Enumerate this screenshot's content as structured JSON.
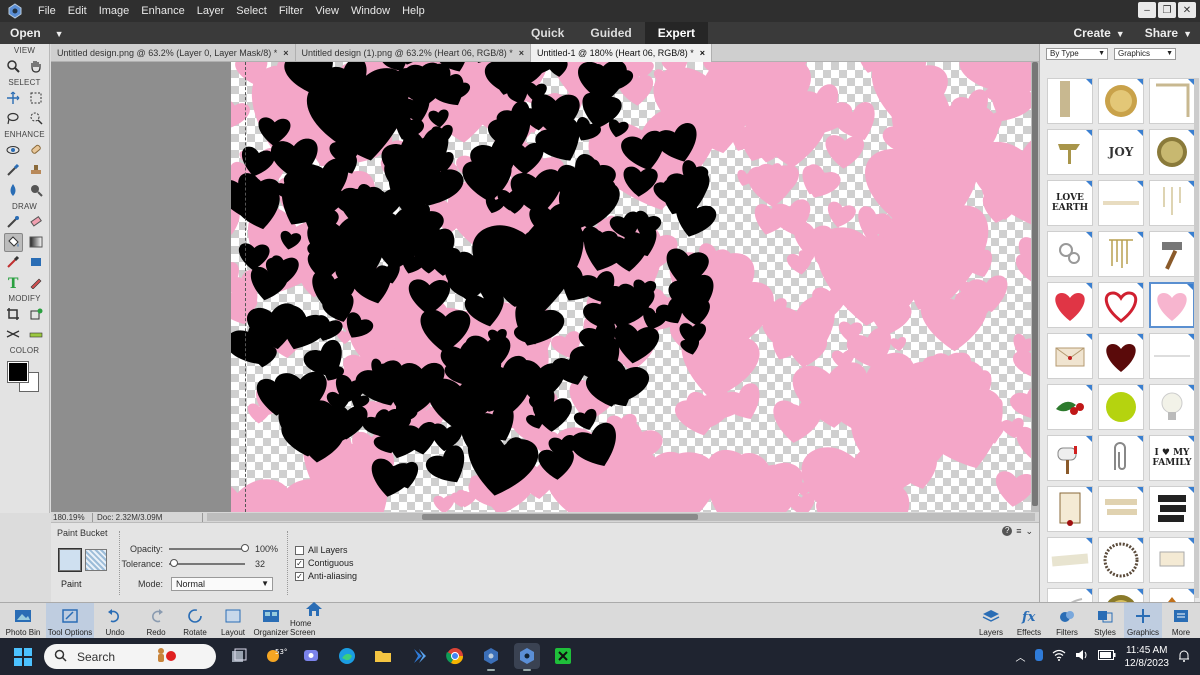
{
  "menubar": {
    "items": [
      "File",
      "Edit",
      "Image",
      "Enhance",
      "Layer",
      "Select",
      "Filter",
      "View",
      "Window",
      "Help"
    ]
  },
  "modebar": {
    "open_label": "Open",
    "modes": [
      "Quick",
      "Guided",
      "Expert"
    ],
    "active_mode": "Expert",
    "create_label": "Create",
    "share_label": "Share"
  },
  "toolbox": {
    "sections": {
      "view": "VIEW",
      "select": "SELECT",
      "enhance": "ENHANCE",
      "draw": "DRAW",
      "modify": "MODIFY",
      "color": "COLOR"
    },
    "foreground_color": "#000000",
    "background_color": "#ffffff"
  },
  "tabs": [
    {
      "label": "Untitled design.png @ 63.2% (Layer 0, Layer Mask/8) *",
      "close": "×"
    },
    {
      "label": "Untitled design (1).png @ 63.2% (Heart 06, RGB/8) *",
      "close": "×"
    },
    {
      "label": "Untitled-1 @ 180% (Heart 06, RGB/8) *",
      "close": "×"
    }
  ],
  "statusbar": {
    "zoom": "180.19%",
    "doc": "Doc: 2.32M/3.09M"
  },
  "options": {
    "tool_name": "Paint Bucket",
    "paint_label": "Paint",
    "opacity_label": "Opacity:",
    "opacity_value": "100%",
    "opacity_fraction": 1.0,
    "tolerance_label": "Tolerance:",
    "tolerance_value": "32",
    "tolerance_fraction": 0.06,
    "mode_label": "Mode:",
    "mode_value": "Normal",
    "all_layers_label": "All Layers",
    "all_layers_checked": false,
    "contiguous_label": "Contiguous",
    "contiguous_checked": true,
    "antialias_label": "Anti-aliasing",
    "antialias_checked": true
  },
  "rightpanel": {
    "filter_type": "By Type",
    "filter_category": "Graphics",
    "thumbs": [
      {
        "name": "lace-corner",
        "text": ""
      },
      {
        "name": "gold-seal",
        "text": ""
      },
      {
        "name": "frame-corner",
        "text": ""
      },
      {
        "name": "paper-clip-gold",
        "text": ""
      },
      {
        "name": "joy-word",
        "text": "JOY"
      },
      {
        "name": "gold-badge",
        "text": ""
      },
      {
        "name": "love-earth-text",
        "text": "LOVE EARTH"
      },
      {
        "name": "ribbon-strip",
        "text": ""
      },
      {
        "name": "hanging-charms",
        "text": ""
      },
      {
        "name": "ring-chain",
        "text": ""
      },
      {
        "name": "gold-strings",
        "text": ""
      },
      {
        "name": "hammer",
        "text": ""
      },
      {
        "name": "red-heart",
        "text": ""
      },
      {
        "name": "outline-heart",
        "text": ""
      },
      {
        "name": "pink-hearts-heart",
        "text": ""
      },
      {
        "name": "envelope",
        "text": ""
      },
      {
        "name": "dark-heart",
        "text": ""
      },
      {
        "name": "line-divider",
        "text": ""
      },
      {
        "name": "holly-berries",
        "text": ""
      },
      {
        "name": "green-circle",
        "text": ""
      },
      {
        "name": "light-bulb",
        "text": ""
      },
      {
        "name": "mailbox",
        "text": ""
      },
      {
        "name": "paper-clip",
        "text": ""
      },
      {
        "name": "i-love-my-family",
        "text": "I ♥ MY FAMILY"
      },
      {
        "name": "scroll-paper",
        "text": ""
      },
      {
        "name": "wood-planks",
        "text": ""
      },
      {
        "name": "black-tags",
        "text": ""
      },
      {
        "name": "washi-tape",
        "text": ""
      },
      {
        "name": "bead-ring",
        "text": ""
      },
      {
        "name": "tag-label",
        "text": ""
      },
      {
        "name": "rope-curl",
        "text": ""
      },
      {
        "name": "gold-button",
        "text": ""
      },
      {
        "name": "autumn-leaf",
        "text": ""
      }
    ]
  },
  "bottombar": {
    "left": [
      {
        "name": "photo-bin",
        "label": "Photo Bin"
      },
      {
        "name": "tool-options",
        "label": "Tool Options"
      },
      {
        "name": "undo",
        "label": "Undo"
      },
      {
        "name": "redo",
        "label": "Redo"
      },
      {
        "name": "rotate",
        "label": "Rotate"
      },
      {
        "name": "layout",
        "label": "Layout"
      },
      {
        "name": "organizer",
        "label": "Organizer"
      },
      {
        "name": "home-screen",
        "label": "Home Screen"
      }
    ],
    "right": [
      {
        "name": "layers",
        "label": "Layers"
      },
      {
        "name": "effects",
        "label": "Effects"
      },
      {
        "name": "filters",
        "label": "Filters"
      },
      {
        "name": "styles",
        "label": "Styles"
      },
      {
        "name": "graphics",
        "label": "Graphics"
      },
      {
        "name": "more",
        "label": "More"
      }
    ]
  },
  "taskbar": {
    "search_placeholder": "Search",
    "weather_temp": "53°",
    "time": "11:45 AM",
    "date": "12/8/2023"
  },
  "colors": {
    "heart_black": "#000000",
    "heart_pink": "#f4a6c8",
    "accent_blue": "#3a7fd0"
  }
}
